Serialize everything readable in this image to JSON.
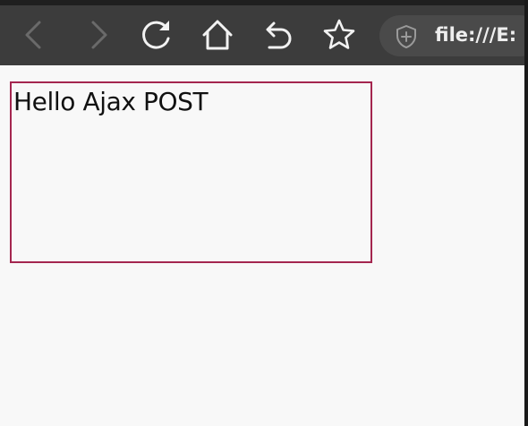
{
  "browser": {
    "toolbar": {
      "buttons": [
        {
          "name": "back",
          "icon": "chevron-left-icon",
          "enabled": false
        },
        {
          "name": "forward",
          "icon": "chevron-right-icon",
          "enabled": false
        },
        {
          "name": "reload",
          "icon": "reload-icon",
          "enabled": true
        },
        {
          "name": "home",
          "icon": "home-icon",
          "enabled": true
        },
        {
          "name": "undo",
          "icon": "undo-icon",
          "enabled": true
        },
        {
          "name": "bookmark",
          "icon": "star-icon",
          "enabled": true
        }
      ]
    },
    "address_bar": {
      "security_icon": "shield-icon",
      "url": "file:///E:"
    }
  },
  "page": {
    "output_text": "Hello Ajax POST"
  },
  "colors": {
    "toolbar_bg": "#3c3c3c",
    "page_bg": "#f8f8f8",
    "box_border": "#a4264f",
    "icon_enabled": "#f2f2f2",
    "icon_disabled": "#6a6a6a"
  }
}
